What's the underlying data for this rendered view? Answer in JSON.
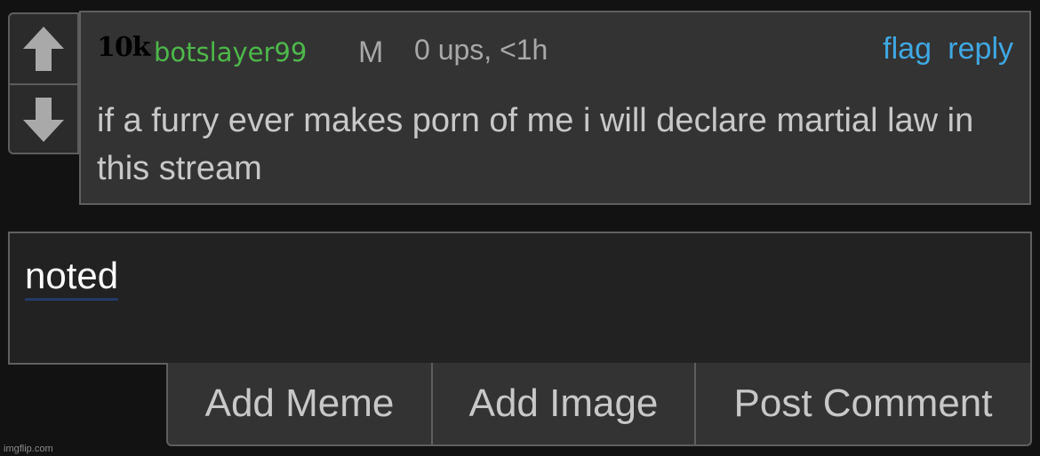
{
  "comment": {
    "badge": "10k",
    "username": "botslayer99",
    "gender": "M",
    "meta": "0 ups, <1h",
    "flag_label": "flag",
    "reply_label": "reply",
    "body": "if a furry ever makes porn of me i will declare martial law in this stream"
  },
  "vote": {
    "up_icon": "arrow-up-icon",
    "down_icon": "arrow-down-icon"
  },
  "reply_box": {
    "value": "noted"
  },
  "buttons": {
    "add_meme": "Add Meme",
    "add_image": "Add Image",
    "post_comment": "Post Comment"
  },
  "watermark": "imgflip.com",
  "colors": {
    "background": "#121212",
    "panel": "#333333",
    "username": "#4eb84a",
    "link": "#3fa8e3",
    "text": "#c8c8c8",
    "muted": "#a8a8a8"
  }
}
